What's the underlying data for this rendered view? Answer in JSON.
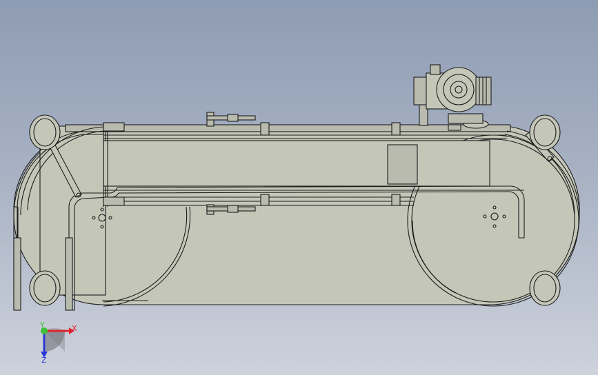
{
  "triad": {
    "x_label": "X",
    "y_label": "Y",
    "z_label": "Z",
    "x_color": "#e0242a",
    "y_color": "#3fbf3a",
    "z_color": "#2a36d8"
  },
  "colors": {
    "background_top": "#8e9cb3",
    "background_bottom": "#cdd2dc",
    "part_fill": "#c4c6b8",
    "edge": "#1c1c1c"
  }
}
